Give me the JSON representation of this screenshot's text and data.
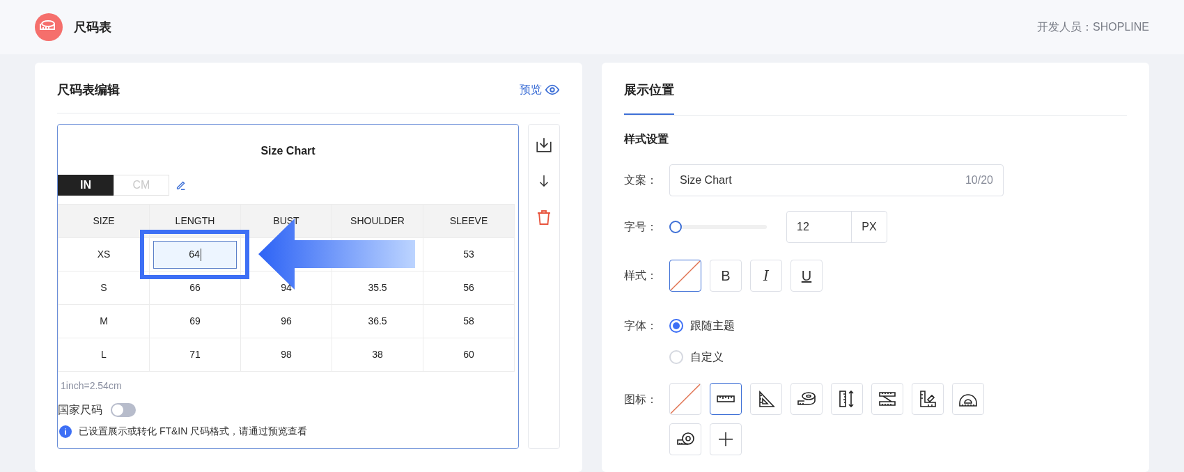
{
  "header": {
    "title": "尺码表",
    "developer": "开发人员：SHOPLINE"
  },
  "editor": {
    "title": "尺码表编辑",
    "preview": "预览",
    "chart_title": "Size Chart",
    "units": [
      {
        "label": "IN",
        "selected": true
      },
      {
        "label": "CM",
        "selected": false
      }
    ],
    "table": {
      "columns": [
        "SIZE",
        "LENGTH",
        "BUST",
        "SHOULDER",
        "SLEEVE"
      ],
      "rows": [
        {
          "cells": [
            {
              "text": "XS"
            },
            {
              "text": "64",
              "editing": true
            },
            {
              "covered": true
            },
            {
              "covered": true
            },
            {
              "text": "53"
            }
          ]
        },
        {
          "cells": [
            {
              "text": "S"
            },
            {
              "text": "66"
            },
            {
              "text": "94"
            },
            {
              "text": "35.5"
            },
            {
              "text": "56"
            }
          ]
        },
        {
          "cells": [
            {
              "text": "M"
            },
            {
              "text": "69"
            },
            {
              "text": "96"
            },
            {
              "text": "36.5"
            },
            {
              "text": "58"
            }
          ]
        },
        {
          "cells": [
            {
              "text": "L"
            },
            {
              "text": "71"
            },
            {
              "text": "98"
            },
            {
              "text": "38"
            },
            {
              "text": "60"
            }
          ]
        }
      ]
    },
    "note": "1inch=2.54cm",
    "national_size": {
      "label": "国家尺码",
      "on": false
    },
    "info": "已设置展示或转化 FT&IN 尺码格式，请通过预览查看"
  },
  "settings": {
    "tabs": [
      {
        "label": "展示位置",
        "selected": true
      }
    ],
    "section": "样式设置",
    "text": {
      "label": "文案：",
      "value": "Size Chart",
      "counter": "10/20"
    },
    "font_size": {
      "label": "字号：",
      "level": 0,
      "value": "12",
      "unit": "PX"
    },
    "style": {
      "label": "样式：",
      "options": [
        {
          "kind": "none",
          "selected": true
        },
        {
          "kind": "bold",
          "label": "B",
          "selected": false
        },
        {
          "kind": "italic",
          "label": "I",
          "selected": false
        },
        {
          "kind": "underline",
          "label": "U",
          "selected": false
        }
      ]
    },
    "font": {
      "label": "字体：",
      "options": [
        {
          "label": "跟随主题",
          "selected": true
        },
        {
          "label": "自定义",
          "selected": false
        }
      ]
    },
    "icon": {
      "label": "图标：",
      "options": [
        {
          "kind": "none",
          "selected": false
        },
        {
          "kind": "ruler",
          "selected": true
        },
        {
          "kind": "triangle",
          "selected": false
        },
        {
          "kind": "tape",
          "selected": false
        },
        {
          "kind": "vertical-ruler",
          "selected": false
        },
        {
          "kind": "folding-ruler",
          "selected": false
        },
        {
          "kind": "square-ruler",
          "selected": false
        },
        {
          "kind": "protractor",
          "selected": false
        },
        {
          "kind": "tape-measure",
          "selected": false
        },
        {
          "kind": "add",
          "selected": false
        }
      ]
    }
  }
}
